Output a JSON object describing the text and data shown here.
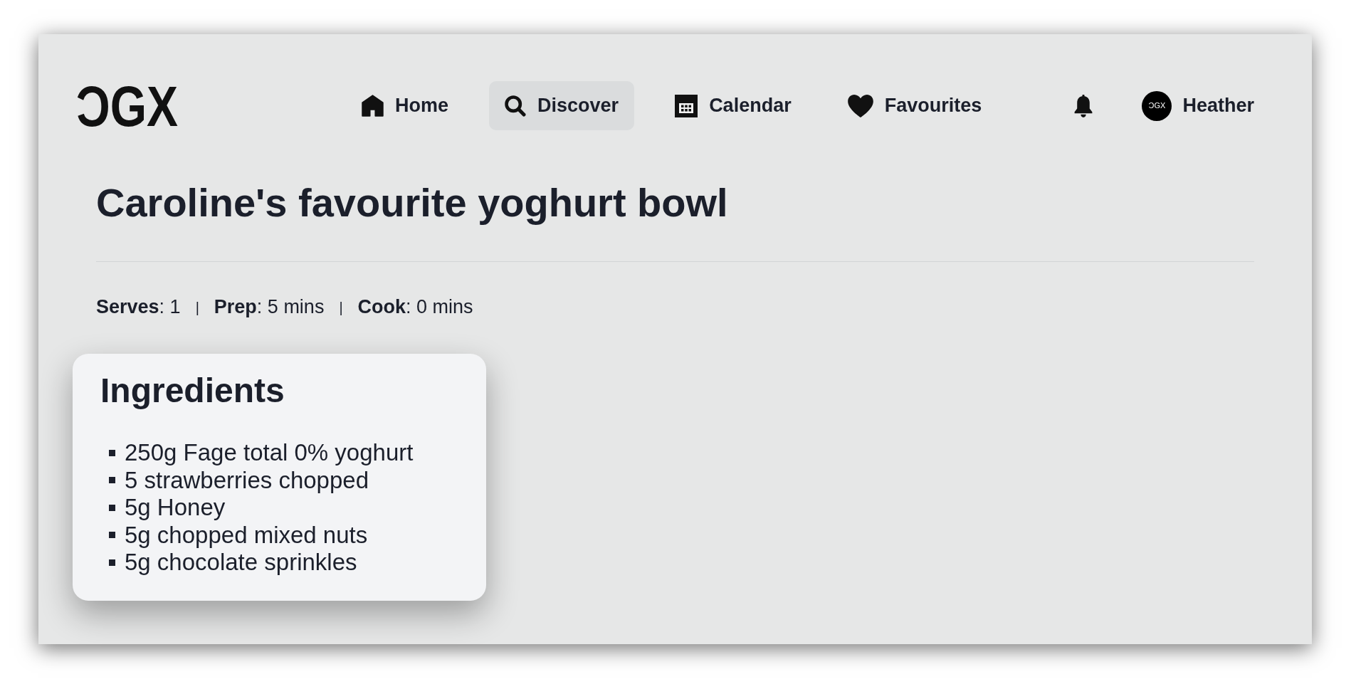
{
  "header": {
    "logo": "ƆGX"
  },
  "nav": [
    {
      "label": "Home",
      "selected": false
    },
    {
      "label": "Discover",
      "selected": true
    },
    {
      "label": "Calendar",
      "selected": false
    },
    {
      "label": "Favourites",
      "selected": false
    }
  ],
  "user": {
    "avatar": "ƆGX",
    "name": "Heather"
  },
  "recipe": {
    "title": "Caroline's favourite yoghurt bowl",
    "meta": [
      {
        "kind": "fact",
        "text": "**Serves**: 1"
      },
      {
        "kind": "separator",
        "text": "|"
      },
      {
        "kind": "fact",
        "text": "**Prep**: 5 mins"
      },
      {
        "kind": "separator",
        "text": "|"
      },
      {
        "kind": "fact",
        "text": "**Cook**: 0 mins"
      }
    ]
  },
  "ingredients": {
    "title": "Ingredients",
    "items": [
      "250g Fage total 0% yoghurt",
      "5 strawberries chopped",
      "5g Honey",
      "5g chopped mixed nuts",
      "5g chocolate sprinkles"
    ]
  }
}
